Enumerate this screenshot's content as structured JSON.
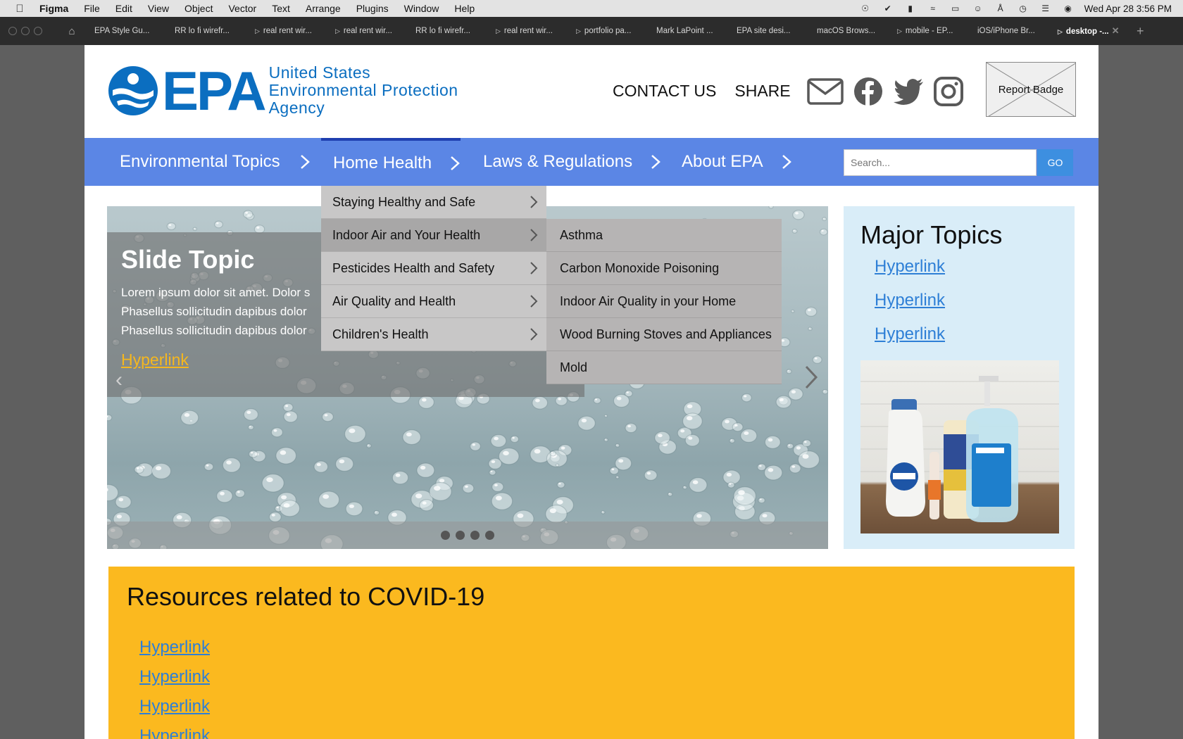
{
  "menubar": {
    "app_name": "Figma",
    "items": [
      "File",
      "Edit",
      "View",
      "Object",
      "Vector",
      "Text",
      "Arrange",
      "Plugins",
      "Window",
      "Help"
    ],
    "clock": "Wed Apr 28  3:56 PM"
  },
  "tabs": [
    {
      "label": "EPA Style Gu...",
      "prototype": false
    },
    {
      "label": "RR lo fi wirefr...",
      "prototype": false
    },
    {
      "label": "real rent wir...",
      "prototype": true
    },
    {
      "label": "real rent wir...",
      "prototype": true
    },
    {
      "label": "RR lo fi wirefr...",
      "prototype": false
    },
    {
      "label": "real rent wir...",
      "prototype": true
    },
    {
      "label": "portfolio pa...",
      "prototype": true
    },
    {
      "label": "Mark LaPoint ...",
      "prototype": false
    },
    {
      "label": "EPA site desi...",
      "prototype": false
    },
    {
      "label": "macOS Brows...",
      "prototype": false
    },
    {
      "label": "mobile - EP...",
      "prototype": true
    },
    {
      "label": "iOS/iPhone Br...",
      "prototype": false
    },
    {
      "label": "desktop -...",
      "prototype": true,
      "active": true
    }
  ],
  "header": {
    "logo_text": "EPA",
    "logo_line1": "United States",
    "logo_line2": "Environmental Protection",
    "logo_line3": "Agency",
    "contact_label": "CONTACT US",
    "share_label": "SHARE",
    "badge_label": "Report Badge"
  },
  "nav": {
    "items": [
      {
        "label": "Environmental Topics"
      },
      {
        "label": "Home Health",
        "active": true
      },
      {
        "label": "Laws & Regulations"
      },
      {
        "label": "About EPA"
      }
    ],
    "search_placeholder": "Search...",
    "go_label": "GO"
  },
  "dropdown": {
    "level1": [
      "Staying Healthy and Safe",
      "Indoor Air and Your Health",
      "Pesticides Health and Safety",
      "Air Quality and Health",
      "Children's Health"
    ],
    "level1_highlighted": 1,
    "level2": [
      "Asthma",
      "Carbon Monoxide Poisoning",
      "Indoor Air Quality in your Home",
      "Wood Burning Stoves and Appliances",
      "Mold"
    ]
  },
  "hero": {
    "title": "Slide Topic",
    "body_line1": "Lorem ipsum dolor sit amet. Dolor s",
    "body_line2": "Phasellus sollicitudin dapibus dolor",
    "body_line3": "Phasellus sollicitudin dapibus dolor",
    "link_label": "Hyperlink",
    "slide_count": 4
  },
  "sidebar": {
    "title": "Major Topics",
    "links": [
      "Hyperlink",
      "Hyperlink",
      "Hyperlink"
    ]
  },
  "covid": {
    "title": "Resources related to COVID-19",
    "links": [
      "Hyperlink",
      "Hyperlink",
      "Hyperlink",
      "Hyperlink"
    ]
  },
  "colors": {
    "nav_bg": "#5b86e5",
    "epa_blue": "#0b6ec0",
    "covid_bg": "#fbb91f",
    "sidebar_bg": "#d9edf8",
    "link": "#2e7fd6",
    "hero_link": "#f5b71e"
  }
}
